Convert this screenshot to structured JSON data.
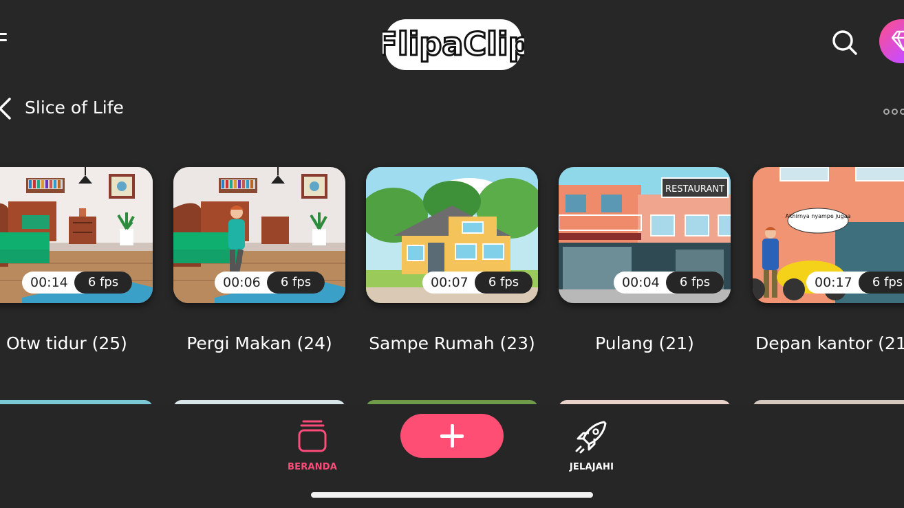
{
  "header": {
    "logo_text": "FlipaClip",
    "menu_icon": "hamburger-menu-icon",
    "search_icon": "search-icon",
    "premium_icon": "diamond-icon",
    "premium_gradient": [
      "#ff4f86",
      "#9a46ff"
    ]
  },
  "section": {
    "back_icon": "chevron-left-icon",
    "title": "Slice of Life",
    "more_icon": "more-dots-icon"
  },
  "projects": [
    {
      "title": "Otw tidur (25)",
      "duration": "00:14",
      "fps": "6 fps",
      "scene": "bedroom"
    },
    {
      "title": "Pergi Makan (24)",
      "duration": "00:06",
      "fps": "6 fps",
      "scene": "bedroom-with-character"
    },
    {
      "title": "Sampe Rumah (23)",
      "duration": "00:07",
      "fps": "6 fps",
      "scene": "house-exterior"
    },
    {
      "title": "Pulang (21)",
      "duration": "00:04",
      "fps": "6 fps",
      "scene": "restaurant-street",
      "sign_text": "RESTAURANT"
    },
    {
      "title": "Depan kantor (21",
      "duration": "00:17",
      "fps": "6 fps",
      "scene": "office-front",
      "bubble_text": "Akhirnya nyampe jugaa"
    }
  ],
  "bottom_nav": {
    "home_label": "BERANDA",
    "home_icon": "stacked-cards-icon",
    "create_icon": "plus-icon",
    "explore_label": "JELAJAHI",
    "explore_icon": "rocket-icon",
    "accent_color": "#ff4e74",
    "active_tab": "BERANDA"
  }
}
